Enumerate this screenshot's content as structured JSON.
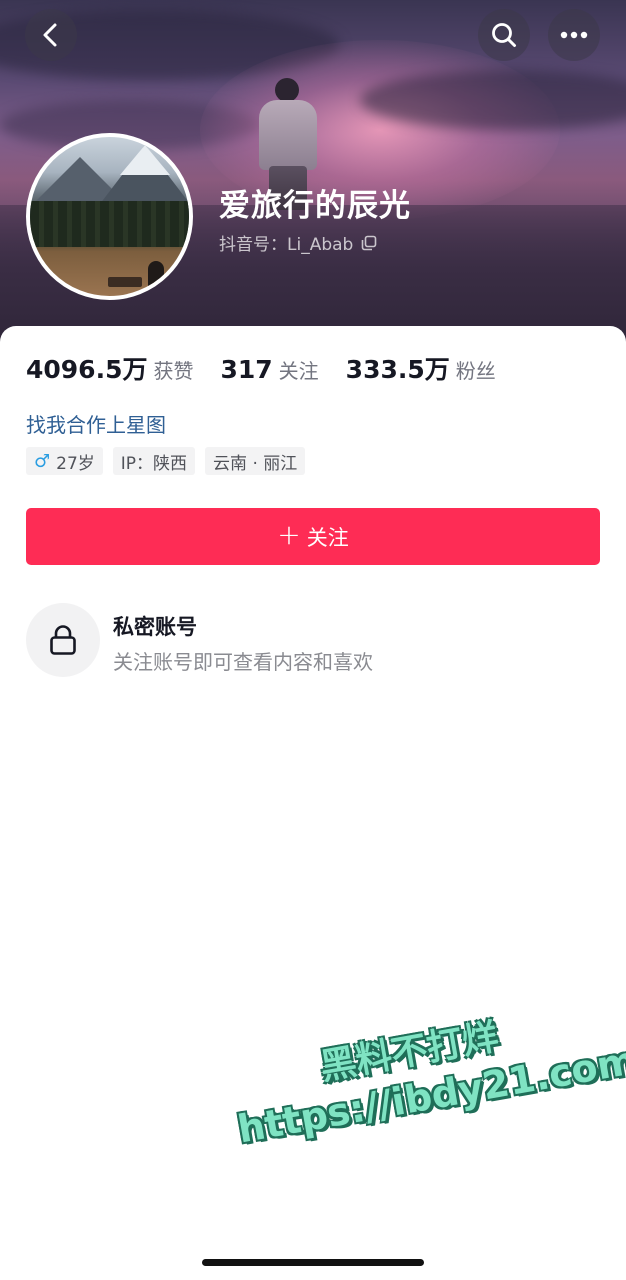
{
  "header": {
    "back_icon": "chevron-left-icon",
    "search_icon": "search-icon",
    "more_icon": "more-horizontal-icon"
  },
  "profile": {
    "name": "爱旅行的辰光",
    "douyin_id_label": "抖音号：",
    "douyin_id": "Li_Abab",
    "copy_icon": "copy-icon"
  },
  "stats": [
    {
      "value": "4096.5万",
      "label": "获赞"
    },
    {
      "value": "317",
      "label": "关注"
    },
    {
      "value": "333.5万",
      "label": "粉丝"
    }
  ],
  "bio": {
    "cooperation_link": "找我合作上星图"
  },
  "tags": {
    "gender_icon": "♂",
    "age": "27岁",
    "ip": "IP：陕西",
    "location": "云南 · 丽江"
  },
  "follow_button": {
    "icon": "+",
    "label": "关注",
    "color": "#fe2c55"
  },
  "private_account": {
    "icon": "lock-icon",
    "title": "私密账号",
    "description": "关注账号即可查看内容和喜欢"
  },
  "watermark": {
    "line1": "黑料不打烊",
    "line2": "https://ibdy21.com"
  }
}
